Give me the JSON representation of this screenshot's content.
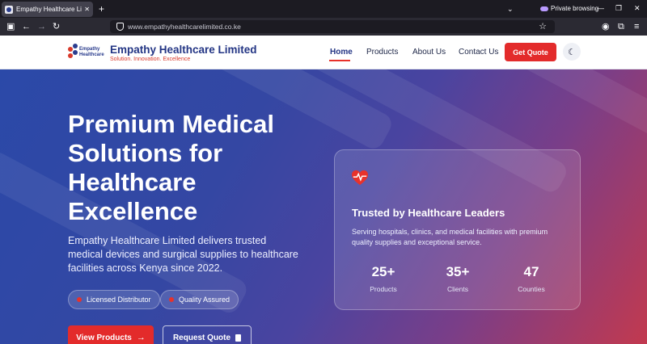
{
  "browser": {
    "tab_title": "Empathy Healthcare Limited | E",
    "tab_close": "✕",
    "new_tab": "+",
    "private_label": "Private browsing",
    "url": "www.empathyhealthcarelimited.co.ke"
  },
  "site": {
    "logo_line1": "Empathy",
    "logo_line2": "Healthcare",
    "brand_name": "Empathy Healthcare Limited",
    "tagline": "Solution. Innovation. Excellence",
    "nav": [
      "Home",
      "Products",
      "About Us",
      "Contact Us"
    ],
    "cta": "Get Quote",
    "theme_icon": "☾"
  },
  "hero": {
    "title": "Premium Medical Solutions for Healthcare Excellence",
    "description": "Empathy Healthcare Limited delivers trusted medical devices and surgical supplies to healthcare facilities across Kenya since 2022.",
    "badges": [
      "Licensed Distributor",
      "Quality Assured"
    ],
    "primary_button": "View Products",
    "secondary_button": "Request Quote"
  },
  "card": {
    "title": "Trusted by Healthcare Leaders",
    "description": "Serving hospitals, clinics, and medical facilities with premium quality supplies and exceptional service.",
    "stats": [
      {
        "value": "25+",
        "label": "Products"
      },
      {
        "value": "35+",
        "label": "Clients"
      },
      {
        "value": "47",
        "label": "Counties"
      }
    ]
  },
  "colors": {
    "brand_blue": "#233584",
    "accent_red": "#e32b2b"
  }
}
